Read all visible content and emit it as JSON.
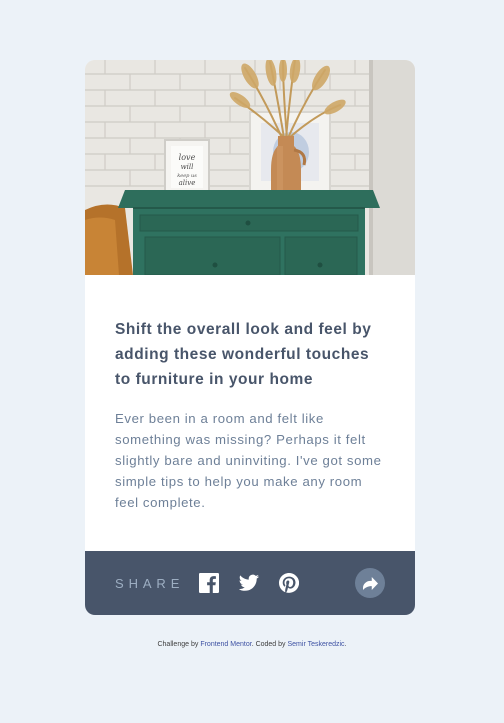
{
  "card": {
    "headline": "Shift the overall look and feel by adding these wonderful touches to furniture in your home",
    "description": "Ever been in a room and felt like something was missing? Perhaps it felt slightly bare and uninviting. I've got some simple tips to help you make any room feel complete.",
    "hero_image": {
      "frame_text": [
        "love",
        "will",
        "keep us",
        "alive"
      ]
    }
  },
  "share": {
    "label": "SHARE",
    "icons": [
      "facebook-icon",
      "twitter-icon",
      "pinterest-icon",
      "share-arrow-icon"
    ]
  },
  "attribution": {
    "prefix": "Challenge by",
    "link1": "Frontend Mentor",
    "middle": ". Coded by",
    "link2": "Semir Teskeredzic",
    "suffix": "."
  },
  "colors": {
    "page_bg": "#ECF2F8",
    "share_bar": "#48556A",
    "share_label": "#9DAEC2",
    "headline": "#48556A",
    "description": "#6E8098",
    "share_button": "#6E8098",
    "dresser_green": "#2E6E5C"
  }
}
